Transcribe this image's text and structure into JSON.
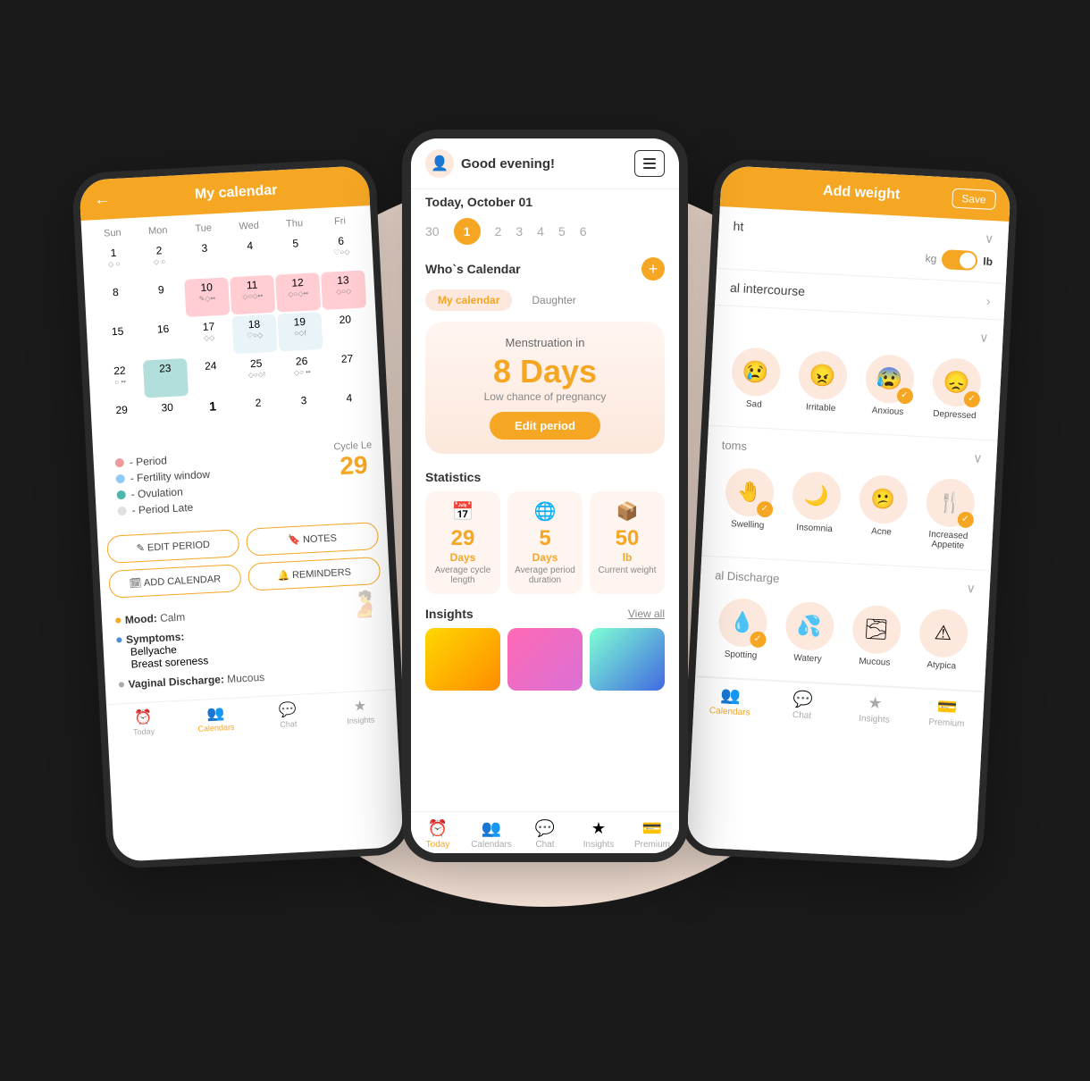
{
  "scene": {
    "bg_color": "#fce8dc"
  },
  "left_phone": {
    "title": "My calendar",
    "back_btn": "←",
    "days": [
      "Sun",
      "Mon",
      "Tue",
      "Wed",
      "Thu",
      "Fri"
    ],
    "weeks": [
      [
        {
          "num": "1",
          "icons": "◇ ○",
          "type": ""
        },
        {
          "num": "2",
          "icons": "◇ ○",
          "type": ""
        },
        {
          "num": "3",
          "icons": "",
          "type": ""
        },
        {
          "num": "4",
          "icons": "",
          "type": ""
        },
        {
          "num": "5",
          "icons": "",
          "type": ""
        },
        {
          "num": "6",
          "icons": "♡○◇",
          "type": ""
        }
      ],
      [
        {
          "num": "8",
          "icons": "",
          "type": ""
        },
        {
          "num": "9",
          "icons": "",
          "type": ""
        },
        {
          "num": "10",
          "icons": "✎◇••",
          "type": "period"
        },
        {
          "num": "11",
          "icons": "◇○◇••",
          "type": "period"
        },
        {
          "num": "12",
          "icons": "◇○◇••",
          "type": "period"
        },
        {
          "num": "13",
          "icons": "◇○◇",
          "type": "period"
        }
      ],
      [
        {
          "num": "15",
          "icons": "",
          "type": ""
        },
        {
          "num": "16",
          "icons": "",
          "type": ""
        },
        {
          "num": "17",
          "icons": "◇◇",
          "type": ""
        },
        {
          "num": "18",
          "icons": "♡○◇",
          "type": "fertility"
        },
        {
          "num": "19",
          "icons": "○◇!",
          "type": "fertility"
        },
        {
          "num": "20",
          "icons": "",
          "type": ""
        }
      ],
      [
        {
          "num": "22",
          "icons": "○ ••",
          "type": ""
        },
        {
          "num": "23",
          "icons": "",
          "type": "ovulation"
        },
        {
          "num": "24",
          "icons": "",
          "type": ""
        },
        {
          "num": "25",
          "icons": "◇○◇!",
          "type": ""
        },
        {
          "num": "26",
          "icons": "◇○ ••",
          "type": ""
        },
        {
          "num": "27",
          "icons": "",
          "type": ""
        }
      ],
      [
        {
          "num": "29",
          "icons": "",
          "type": ""
        },
        {
          "num": "30",
          "icons": "",
          "type": ""
        },
        {
          "num": "1",
          "icons": "",
          "type": "bold"
        },
        {
          "num": "2",
          "icons": "",
          "type": ""
        },
        {
          "num": "3",
          "icons": "",
          "type": ""
        },
        {
          "num": "4",
          "icons": "",
          "type": ""
        }
      ]
    ],
    "legend": [
      {
        "color": "#ef9a9a",
        "label": "- Period"
      },
      {
        "color": "#90caf9",
        "label": "- Fertility window"
      },
      {
        "color": "#4db6ac",
        "label": "- Ovulation"
      },
      {
        "color": "#e0e0e0",
        "label": "- Period Late"
      }
    ],
    "cycle_length_label": "Cycle Le",
    "cycle_number": "29",
    "buttons": {
      "edit_period": "✎ EDIT PERIOD",
      "notes": "🔖 NOTES",
      "add_calendar": "🗓 ADD CALENDAR",
      "reminders": "🔔 REMINDERS"
    },
    "info": {
      "mood_label": "Mood:",
      "mood_value": "Calm",
      "symptoms_label": "Symptoms:",
      "symptoms_values": [
        "Bellyache",
        "Breast soreness"
      ],
      "discharge_label": "Vaginal Discharge:",
      "discharge_value": "Mucous"
    },
    "nav": {
      "items": [
        {
          "icon": "⏰",
          "label": "Today",
          "active": false
        },
        {
          "icon": "👤👤",
          "label": "Calendars",
          "active": true
        },
        {
          "icon": "💬",
          "label": "Chat",
          "active": false
        },
        {
          "icon": "★",
          "label": "Insights",
          "active": false
        }
      ]
    }
  },
  "center_phone": {
    "greeting": "Good evening!",
    "date": "Today, October 01",
    "date_nums": [
      "30",
      "1",
      "2",
      "3",
      "4",
      "5",
      "6"
    ],
    "active_date": "1",
    "whos_calendar_label": "Who`s Calendar",
    "calendar_tabs": [
      "My calendar",
      "Daughter"
    ],
    "active_tab": "My calendar",
    "menstruation_label": "Menstruation in",
    "days_number": "8 Days",
    "pregnancy_chance": "Low chance of pregnancy",
    "edit_period_btn": "Edit period",
    "statistics_title": "Statistics",
    "stats": [
      {
        "icon": "📅",
        "number": "29",
        "unit": "Days",
        "desc": "Average cycle length"
      },
      {
        "icon": "🌐",
        "number": "5",
        "unit": "Days",
        "desc": "Average period duration"
      },
      {
        "icon": "📦",
        "number": "50",
        "unit": "lb",
        "desc": "Current weight"
      }
    ],
    "insights_title": "Insights",
    "view_all": "View all",
    "nav": {
      "items": [
        {
          "icon": "⏰",
          "label": "Today",
          "active": true
        },
        {
          "icon": "👤👤",
          "label": "Calendars",
          "active": false
        },
        {
          "icon": "💬",
          "label": "Chat",
          "active": false
        },
        {
          "icon": "★",
          "label": "Insights",
          "active": false
        },
        {
          "icon": "💳",
          "label": "Premium",
          "active": false
        }
      ]
    }
  },
  "right_phone": {
    "title": "Add weight",
    "save_btn": "Save",
    "weight_toggle": {
      "kg": "kg",
      "lb": "lb",
      "active": "lb"
    },
    "sexual_intercourse_label": "al intercourse",
    "moods": {
      "section_label": "",
      "items": [
        {
          "emoji": "😢",
          "label": "Sad",
          "selected": false
        },
        {
          "emoji": "😠",
          "label": "Irritable",
          "selected": false
        },
        {
          "emoji": "😰",
          "label": "Anxious",
          "selected": true
        },
        {
          "emoji": "😞",
          "label": "Depressed",
          "selected": true
        }
      ]
    },
    "symptoms": {
      "section_label": "toms",
      "items": [
        {
          "emoji": "🤚",
          "label": "Swelling",
          "selected": true
        },
        {
          "emoji": "🌙",
          "label": "Insomnia",
          "selected": false
        },
        {
          "emoji": "😕",
          "label": "Acne",
          "selected": false
        },
        {
          "emoji": "🍴",
          "label": "Increased Appetite",
          "selected": true
        }
      ]
    },
    "discharge": {
      "section_label": "al Discharge",
      "items": [
        {
          "emoji": "💧",
          "label": "Spotting",
          "selected": true
        },
        {
          "emoji": "💦",
          "label": "Watery",
          "selected": false
        },
        {
          "emoji": "🌫",
          "label": "Mucous",
          "selected": false
        },
        {
          "emoji": "⚠",
          "label": "Atypica",
          "selected": false
        }
      ]
    },
    "nav": {
      "items": [
        {
          "icon": "👤👤",
          "label": "Calendars",
          "active": true
        },
        {
          "icon": "💬",
          "label": "Chat",
          "active": false
        },
        {
          "icon": "★",
          "label": "Insights",
          "active": false
        },
        {
          "icon": "💳",
          "label": "Premium",
          "active": false
        }
      ]
    }
  }
}
